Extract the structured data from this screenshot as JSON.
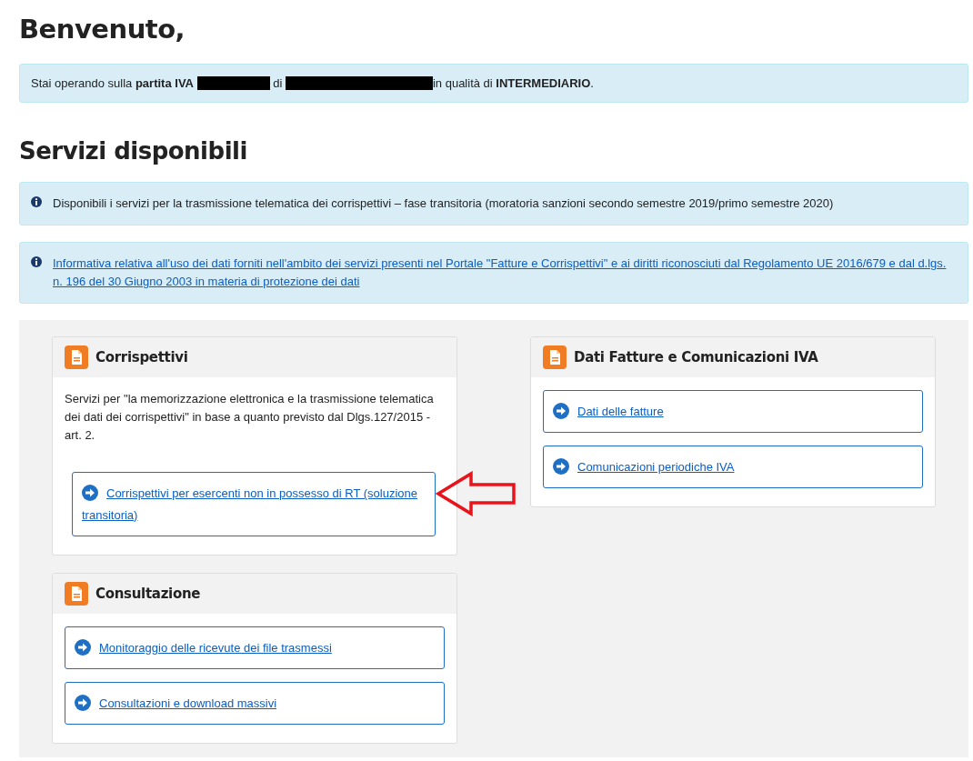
{
  "greeting": "Benvenuto,",
  "operating_notice": [
    {
      "kind": "text",
      "text": "Stai operando sulla **partita IVA** "
    },
    {
      "kind": "short_redaction"
    },
    {
      "kind": "text",
      "text": " di "
    },
    {
      "kind": "long_redaction"
    },
    {
      "kind": "text",
      "text": "in qualità di **INTERMEDIARIO**."
    }
  ],
  "section_title": "Servizi disponibili",
  "info_messages": [
    {
      "kind": "text",
      "text": "Disponibili i servizi per la trasmissione telematica dei corrispettivi – fase transitoria (moratoria sanzioni secondo semestre 2019/primo semestre 2020)"
    },
    {
      "kind": "link",
      "text": "Informativa relativa all'uso dei dati forniti nell'ambito dei servizi presenti nel Portale \"Fatture e Corrispettivi\" e ai diritti riconosciuti dal Regolamento UE 2016/679 e dal d.lgs. n. 196 del 30 Giugno 2003 in materia di protezione dei dati"
    }
  ],
  "columns": [
    {
      "cards": [
        {
          "title": "Corrispettivi",
          "description": "Servizi per \"la memorizzazione elettronica e la trasmissione telematica dei dati dei corrispettivi\" in base a quanto previsto dal Dlgs.127/2015 - art. 2.",
          "links": [
            "Corrispettivi per esercenti non in possesso di RT (soluzione transitoria)"
          ]
        },
        {
          "title": "Consultazione",
          "links": [
            "Monitoraggio delle ricevute dei file trasmessi",
            "Consultazioni e download massivi"
          ]
        }
      ]
    },
    {
      "cards": [
        {
          "title": "Dati Fatture e Comunicazioni IVA",
          "links": [
            "Dati delle fatture",
            "Comunicazioni periodiche IVA"
          ]
        }
      ]
    }
  ]
}
